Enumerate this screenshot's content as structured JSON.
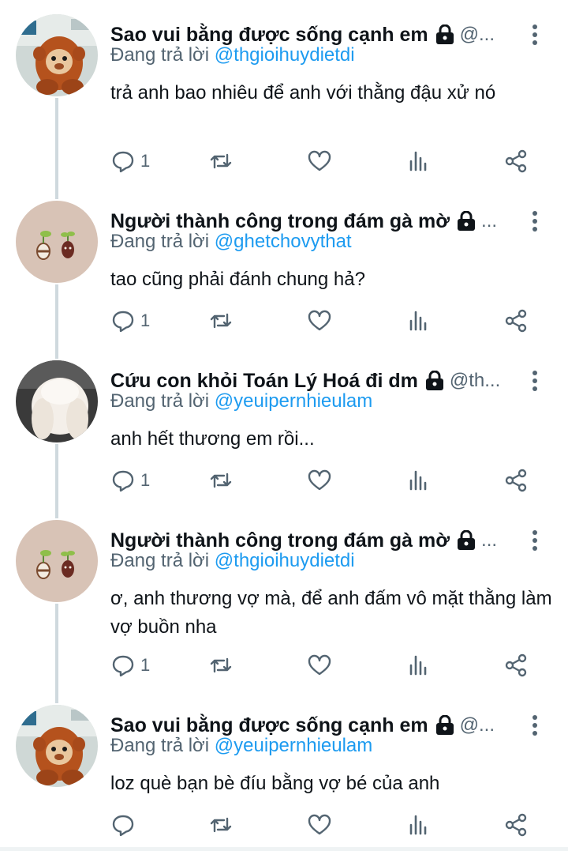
{
  "reply_prefix": "Đang trả lời",
  "tweets": [
    {
      "name": "Sao vui bằng được sống cạnh em",
      "handle": "@...",
      "reply_to": "@thgioihuydietdi",
      "text": "trả anh bao nhiêu để anh với thằng đậu xử nó",
      "reply_count": "1",
      "avatar": "orangutan-plush"
    },
    {
      "name": "Người thành công trong đám gà mờ",
      "handle": "...",
      "reply_to": "@ghetchovythat",
      "text": "tao cũng phải đánh chung hả?",
      "reply_count": "1",
      "avatar": "sprouting-beans"
    },
    {
      "name": "Cứu con khỏi Toán Lý Hoá đi dm",
      "handle": "@th...",
      "reply_to": "@yeuipernhieulam",
      "text": "anh hết thương em rồi...",
      "reply_count": "1",
      "avatar": "white-rabbit"
    },
    {
      "name": "Người thành công trong đám gà mờ",
      "handle": "...",
      "reply_to": "@thgioihuydietdi",
      "text": "ơ, anh thương vợ mà, để anh đấm vô mặt thằng làm vợ buồn nha",
      "reply_count": "1",
      "avatar": "sprouting-beans"
    },
    {
      "name": "Sao vui bằng được sống cạnh em",
      "handle": "@...",
      "reply_to": "@yeuipernhieulam",
      "text": "loz què bạn bè đíu bằng vợ bé của anh",
      "reply_count": "",
      "avatar": "orangutan-plush"
    }
  ],
  "icons": {
    "reply": "reply-icon",
    "retweet": "retweet-icon",
    "like": "heart-icon",
    "views": "analytics-icon",
    "share": "share-icon",
    "lock": "lock-icon",
    "more": "more-vertical-icon"
  },
  "colors": {
    "mention": "#1d9bf0",
    "secondary_text": "#536471",
    "thread_line": "#cfd9de"
  }
}
